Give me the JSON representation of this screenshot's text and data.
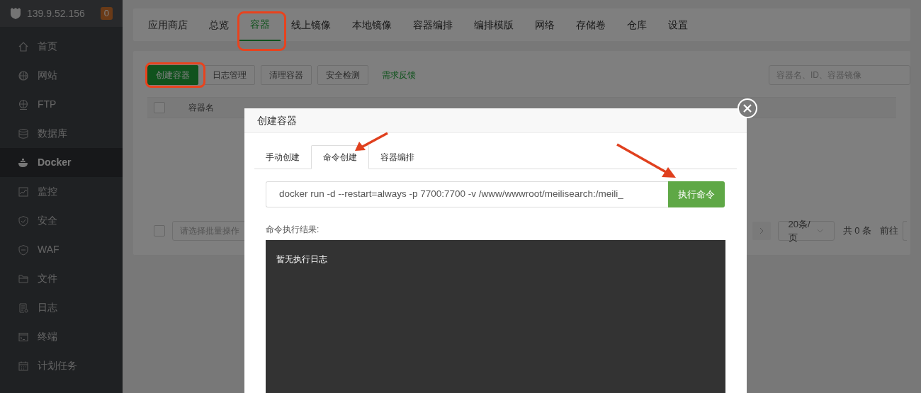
{
  "sidebar": {
    "host": "139.9.52.156",
    "badge": "0",
    "items": [
      {
        "label": "首页",
        "selected": false
      },
      {
        "label": "网站",
        "selected": false
      },
      {
        "label": "FTP",
        "selected": false
      },
      {
        "label": "数据库",
        "selected": false
      },
      {
        "label": "Docker",
        "selected": true
      },
      {
        "label": "监控",
        "selected": false
      },
      {
        "label": "安全",
        "selected": false
      },
      {
        "label": "WAF",
        "selected": false
      },
      {
        "label": "文件",
        "selected": false
      },
      {
        "label": "日志",
        "selected": false
      },
      {
        "label": "终端",
        "selected": false
      },
      {
        "label": "计划任务",
        "selected": false
      }
    ]
  },
  "top_tabs": [
    {
      "label": "应用商店",
      "selected": false,
      "highlighted": false
    },
    {
      "label": "总览",
      "selected": false,
      "highlighted": false
    },
    {
      "label": "容器",
      "selected": true,
      "highlighted": true
    },
    {
      "label": "线上镜像",
      "selected": false,
      "highlighted": false
    },
    {
      "label": "本地镜像",
      "selected": false,
      "highlighted": false
    },
    {
      "label": "容器编排",
      "selected": false,
      "highlighted": false
    },
    {
      "label": "编排模版",
      "selected": false,
      "highlighted": false
    },
    {
      "label": "网络",
      "selected": false,
      "highlighted": false
    },
    {
      "label": "存储卷",
      "selected": false,
      "highlighted": false
    },
    {
      "label": "仓库",
      "selected": false,
      "highlighted": false
    },
    {
      "label": "设置",
      "selected": false,
      "highlighted": false
    }
  ],
  "toolbar": {
    "buttons": [
      {
        "label": "创建容器",
        "kind": "primary",
        "highlighted": true
      },
      {
        "label": "日志管理",
        "kind": "default",
        "highlighted": false
      },
      {
        "label": "清理容器",
        "kind": "default",
        "highlighted": false
      },
      {
        "label": "安全检测",
        "kind": "default",
        "highlighted": false
      },
      {
        "label": "需求反馈",
        "kind": "link",
        "highlighted": false
      }
    ],
    "search": {
      "placeholder": "容器名、ID、容器镜像"
    }
  },
  "table": {
    "select_all": {
      "checked": false
    },
    "columns": [
      {
        "label": "容器名"
      }
    ]
  },
  "footer": {
    "select_all": {
      "checked": false
    },
    "batch_select": {
      "placeholder": "请选择批量操作"
    },
    "page_size": "20条/页",
    "total": "共 0 条",
    "goto_label": "前往"
  },
  "dialog": {
    "title": "创建容器",
    "tabs": [
      {
        "label": "手动创建",
        "selected": false
      },
      {
        "label": "命令创建",
        "selected": true
      },
      {
        "label": "容器编排",
        "selected": false
      }
    ],
    "command": {
      "value": "docker run -d --restart=always -p 7700:7700 -v /www/wwwroot/meilisearch:/meili_"
    },
    "run_button": "执行命令",
    "result_label": "命令执行结果:",
    "log": "暂无执行日志"
  }
}
